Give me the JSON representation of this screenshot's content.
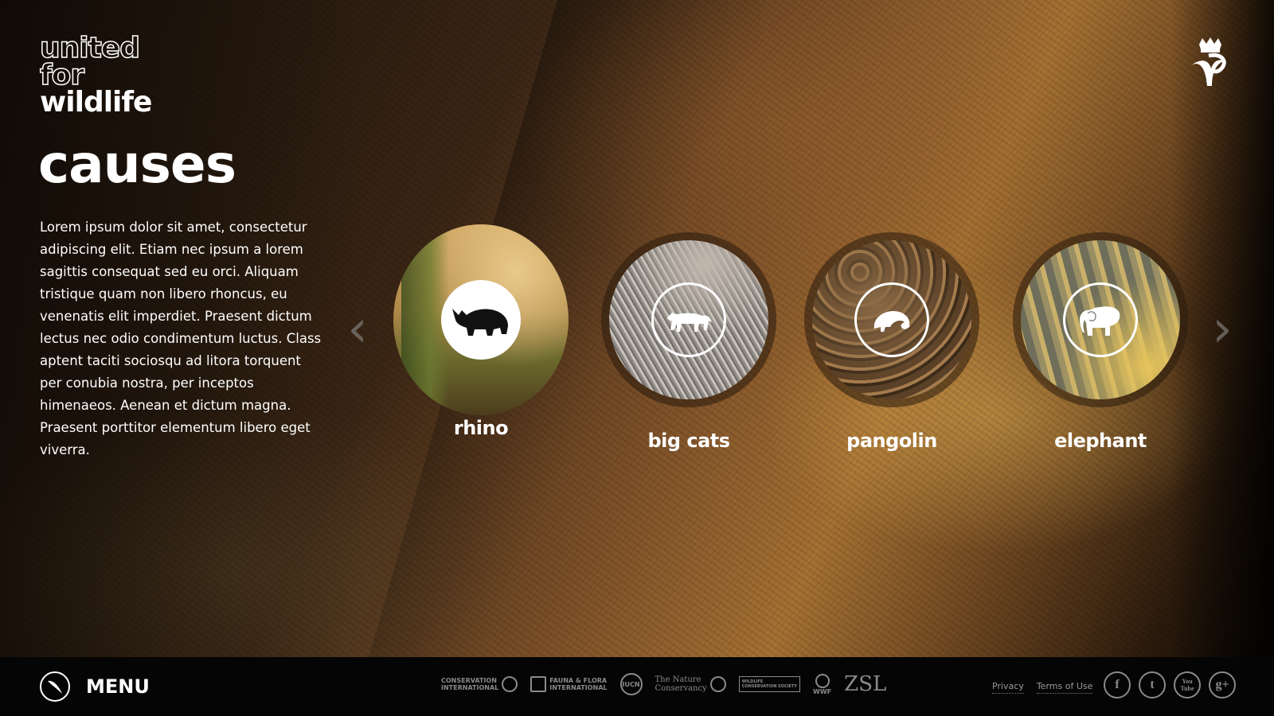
{
  "brand": {
    "line1": "united",
    "line2": "for",
    "line3": "wildlife"
  },
  "page": {
    "title": "causes",
    "intro": "Lorem ipsum dolor sit amet, consectetur adipiscing elit. Etiam nec ipsum a lorem sagittis consequat sed eu orci. Aliquam tristique quam non libero rhoncus, eu venenatis elit imperdiet. Praesent dictum lectus nec odio condimentum luctus. Class aptent taciti sociosqu ad litora torquent per conubia nostra, per inceptos himenaeos. Aenean et dictum magna. Praesent porttitor elementum libero eget viverra."
  },
  "carousel": {
    "prev_icon": "chevron-left-icon",
    "next_icon": "chevron-right-icon",
    "causes": [
      {
        "label": "rhino",
        "icon": "rhino-icon",
        "active": true
      },
      {
        "label": "big cats",
        "icon": "big-cat-icon",
        "active": false
      },
      {
        "label": "pangolin",
        "icon": "pangolin-icon",
        "active": false
      },
      {
        "label": "elephant",
        "icon": "elephant-icon",
        "active": false
      }
    ]
  },
  "footer": {
    "menu_label": "MENU",
    "partners": [
      {
        "line1": "CONSERVATION",
        "line2": "INTERNATIONAL"
      },
      {
        "line1": "FAUNA & FLORA",
        "line2": "INTERNATIONAL"
      },
      {
        "line1": "IUCN",
        "line2": ""
      },
      {
        "line1": "The Nature",
        "line2": "Conservancy"
      },
      {
        "line1": "WILDLIFE",
        "line2": "CONSERVATION SOCIETY"
      },
      {
        "line1": "WWF",
        "line2": ""
      },
      {
        "line1": "ZSL",
        "line2": ""
      }
    ],
    "privacy": "Privacy",
    "terms": "Terms of Use",
    "social": [
      "f",
      "t",
      "You Tube",
      "g+"
    ]
  },
  "colors": {
    "text": "#ffffff",
    "footer_bg": "#050505",
    "muted": "#8a8a8a"
  }
}
